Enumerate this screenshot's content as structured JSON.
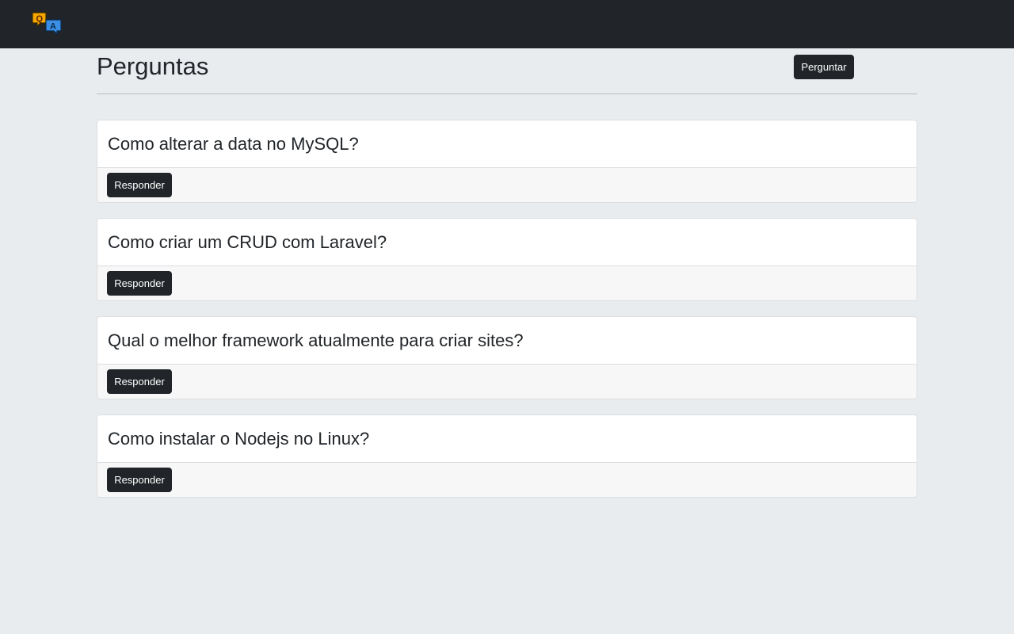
{
  "navbar": {
    "logo_icon": "q-and-a-speech-bubbles-icon",
    "colors": {
      "background": "#212529"
    }
  },
  "page": {
    "title": "Perguntas",
    "ask_button_label": "Perguntar",
    "colors": {
      "background": "#e9ecef",
      "button": "#212529"
    }
  },
  "questions": [
    {
      "title": "Como alterar a data no MySQL?",
      "answer_label": "Responder"
    },
    {
      "title": "Como criar um CRUD com Laravel?",
      "answer_label": "Responder"
    },
    {
      "title": "Qual o melhor framework atualmente para criar sites?",
      "answer_label": "Responder"
    },
    {
      "title": "Como instalar o Nodejs no Linux?",
      "answer_label": "Responder"
    }
  ]
}
